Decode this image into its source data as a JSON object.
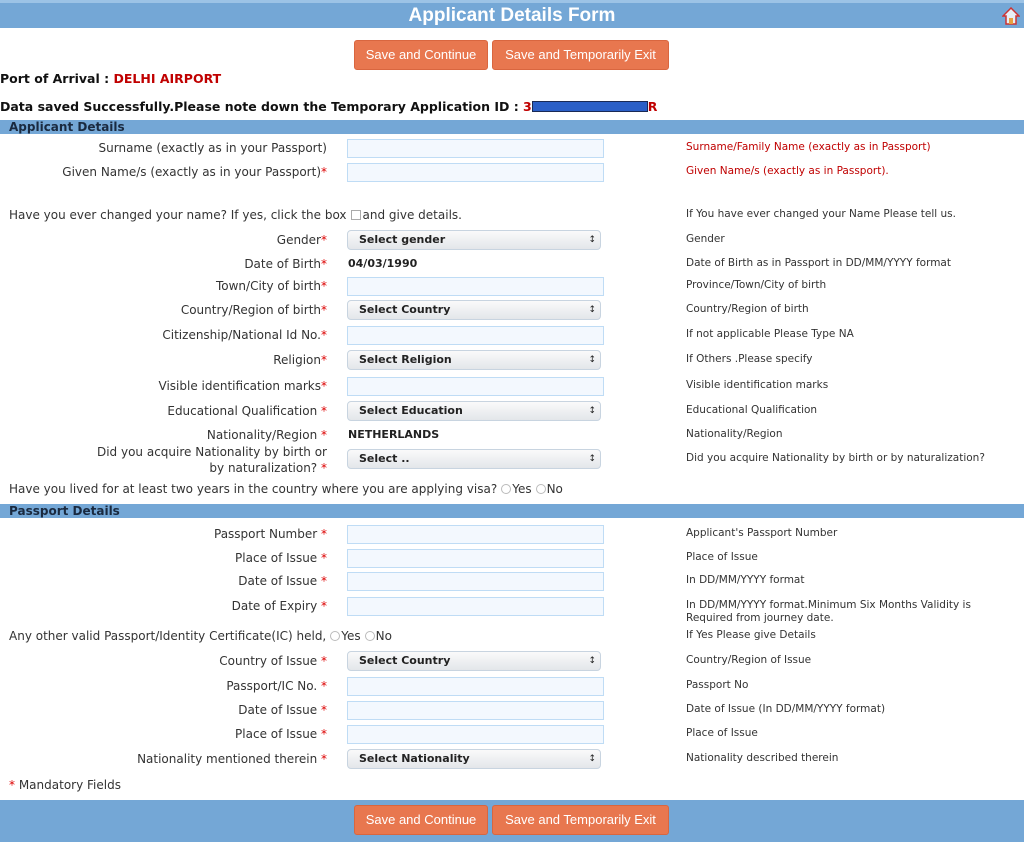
{
  "header": {
    "title": "Applicant Details Form",
    "home_icon": "home-icon"
  },
  "buttons": {
    "save_continue": "Save and Continue",
    "save_exit": "Save and Temporarily Exit"
  },
  "port": {
    "label": "Port of Arrival : ",
    "value": "DELHI AIRPORT"
  },
  "saved": {
    "message": "Data saved Successfully.Please note down the Temporary Application ID : ",
    "id_start": "3",
    "id_end": "R"
  },
  "sections": {
    "applicant": "Applicant Details",
    "passport": "Passport Details"
  },
  "rows": [
    {
      "type": "input",
      "label": "Surname (exactly as in your Passport)",
      "req": false,
      "hint": "Surname/Family Name (exactly as in Passport)",
      "hint_red": true
    },
    {
      "type": "input",
      "label": "Given Name/s (exactly as in your Passport)",
      "req": true,
      "hint": "Given Name/s (exactly as in Passport).",
      "hint_red": true
    },
    {
      "type": "check",
      "label": "Have you ever changed your name? If yes, click the box",
      "after": "and give details.",
      "hint": "If You have ever changed your Name Please tell us."
    },
    {
      "type": "select",
      "label": "Gender",
      "req": true,
      "value": "Select gender",
      "hint": "Gender"
    },
    {
      "type": "text",
      "label": "Date of Birth",
      "req": true,
      "value": "04/03/1990",
      "hint": "Date of Birth as in Passport in DD/MM/YYYY format"
    },
    {
      "type": "input",
      "label": "Town/City of birth",
      "req": true,
      "hint": "Province/Town/City of birth"
    },
    {
      "type": "select",
      "label": "Country/Region of birth",
      "req": true,
      "value": "Select Country",
      "hint": "Country/Region of birth"
    },
    {
      "type": "input",
      "label": "Citizenship/National Id No.",
      "req": true,
      "hint": "If not applicable Please Type NA"
    },
    {
      "type": "select",
      "label": "Religion",
      "req": true,
      "value": "Select Religion",
      "hint": "If Others .Please specify"
    },
    {
      "type": "input",
      "label": "Visible identification marks",
      "req": true,
      "hint": "Visible identification marks"
    },
    {
      "type": "select",
      "label": "Educational Qualification ",
      "req": true,
      "value": "Select Education",
      "hint": "Educational Qualification"
    },
    {
      "type": "text",
      "label": "Nationality/Region ",
      "req": true,
      "value": "NETHERLANDS",
      "hint": "Nationality/Region"
    },
    {
      "type": "select",
      "label": "Did you acquire Nationality by birth or by naturalization? ",
      "req": true,
      "value": "Select ..",
      "hint": "Did you acquire Nationality by birth or by naturalization?"
    },
    {
      "type": "radio",
      "label": "Have you lived for at least two years in the country where you are applying visa?",
      "yes": "Yes",
      "no": "No"
    },
    {
      "type": "section",
      "key": "passport"
    },
    {
      "type": "input",
      "label": "Passport Number ",
      "req": true,
      "hint": "Applicant's Passport Number"
    },
    {
      "type": "input",
      "label": "Place of Issue ",
      "req": true,
      "hint": "Place of Issue"
    },
    {
      "type": "input",
      "label": "Date of Issue ",
      "req": true,
      "hint": "In DD/MM/YYYY format"
    },
    {
      "type": "input",
      "label": "Date of Expiry ",
      "req": true,
      "hint": "In DD/MM/YYYY format.Minimum Six Months Validity is Required from journey date."
    },
    {
      "type": "radio",
      "label": "Any other valid Passport/Identity Certificate(IC) held,",
      "yes": "Yes",
      "no": "No",
      "hint": "If Yes Please give Details"
    },
    {
      "type": "select",
      "label": "Country of Issue ",
      "req": true,
      "value": "Select Country",
      "hint": "Country/Region of Issue"
    },
    {
      "type": "input",
      "label": "Passport/IC No. ",
      "req": true,
      "hint": "Passport No"
    },
    {
      "type": "input",
      "label": "Date of Issue ",
      "req": true,
      "hint": "Date of Issue (In DD/MM/YYYY format)"
    },
    {
      "type": "input",
      "label": "Place of Issue ",
      "req": true,
      "hint": "Place of Issue"
    },
    {
      "type": "select",
      "label": "Nationality mentioned therein ",
      "req": true,
      "value": "Select Nationality",
      "hint": "Nationality described therein"
    }
  ],
  "mandatory": "Mandatory Fields",
  "colors": {
    "header": "#74a7d6",
    "button": "#e8774f",
    "required": "#c00000"
  }
}
